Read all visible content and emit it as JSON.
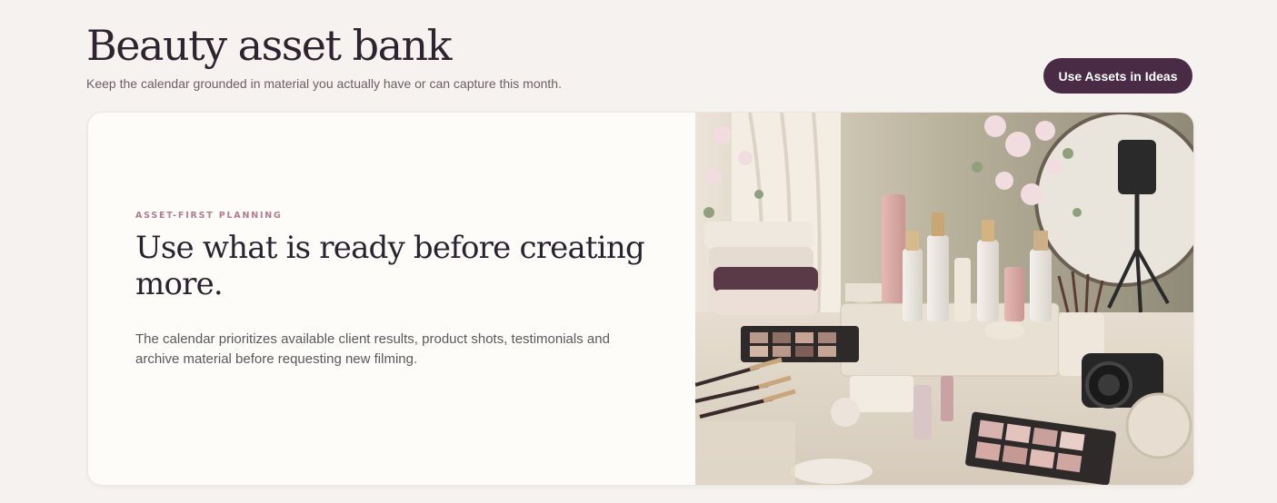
{
  "header": {
    "title": "Beauty asset bank",
    "subtitle": "Keep the calendar grounded in material you actually have or can capture this month."
  },
  "actions": {
    "use_assets_label": "Use Assets in Ideas"
  },
  "hero": {
    "eyebrow": "ASSET-FIRST PLANNING",
    "heading": "Use what is ready before creating more.",
    "body": "The calendar prioritizes available client results, product shots, testimonials and archive material before requesting new filming."
  },
  "colors": {
    "background": "#f6f2ef",
    "accent": "#4a2b45",
    "eyebrow": "#b47a8e",
    "card": "#fdfcf8"
  }
}
